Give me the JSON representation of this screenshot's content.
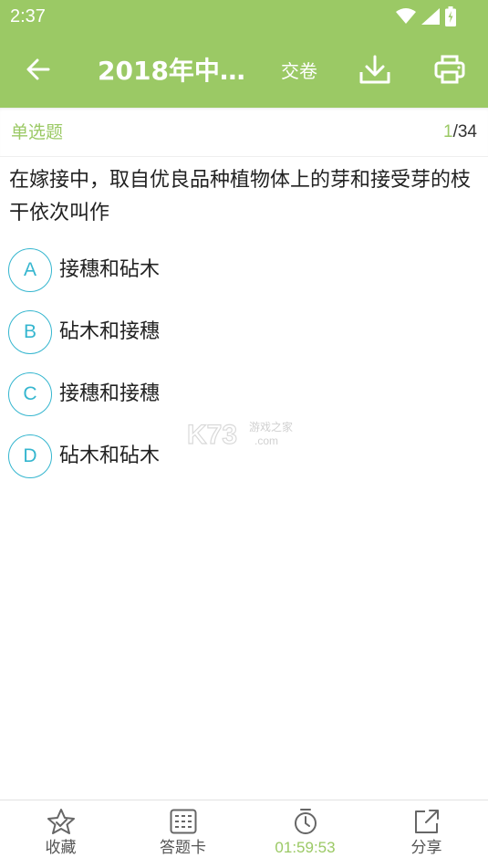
{
  "status_bar": {
    "time": "2:37",
    "icons": [
      "wifi-icon",
      "signal-icon",
      "battery-icon"
    ]
  },
  "app_bar": {
    "back_icon": "arrow-left-icon",
    "title": "2018年中…",
    "submit_label": "交卷",
    "download_icon": "download-icon",
    "print_icon": "printer-icon"
  },
  "question": {
    "type_label": "单选题",
    "current": "1",
    "total": "/34",
    "text": "在嫁接中，取自优良品种植物体上的芽和接受芽的枝干依次叫作",
    "options": [
      {
        "letter": "A",
        "text": "接穗和砧木"
      },
      {
        "letter": "B",
        "text": "砧木和接穗"
      },
      {
        "letter": "C",
        "text": "接穗和接穗"
      },
      {
        "letter": "D",
        "text": "砧木和砧木"
      }
    ]
  },
  "watermark": {
    "text": "K73",
    "subtext": "游戏之家",
    "domain": ".com"
  },
  "bottom_nav": {
    "items": [
      {
        "label": "收藏",
        "icon": "star-check-icon"
      },
      {
        "label": "答题卡",
        "icon": "answer-card-icon"
      },
      {
        "label": "01:59:53",
        "icon": "stopwatch-icon"
      },
      {
        "label": "分享",
        "icon": "share-icon"
      }
    ]
  },
  "colors": {
    "primary": "#9bc965",
    "option_accent": "#35b6cf",
    "text": "#222222"
  }
}
